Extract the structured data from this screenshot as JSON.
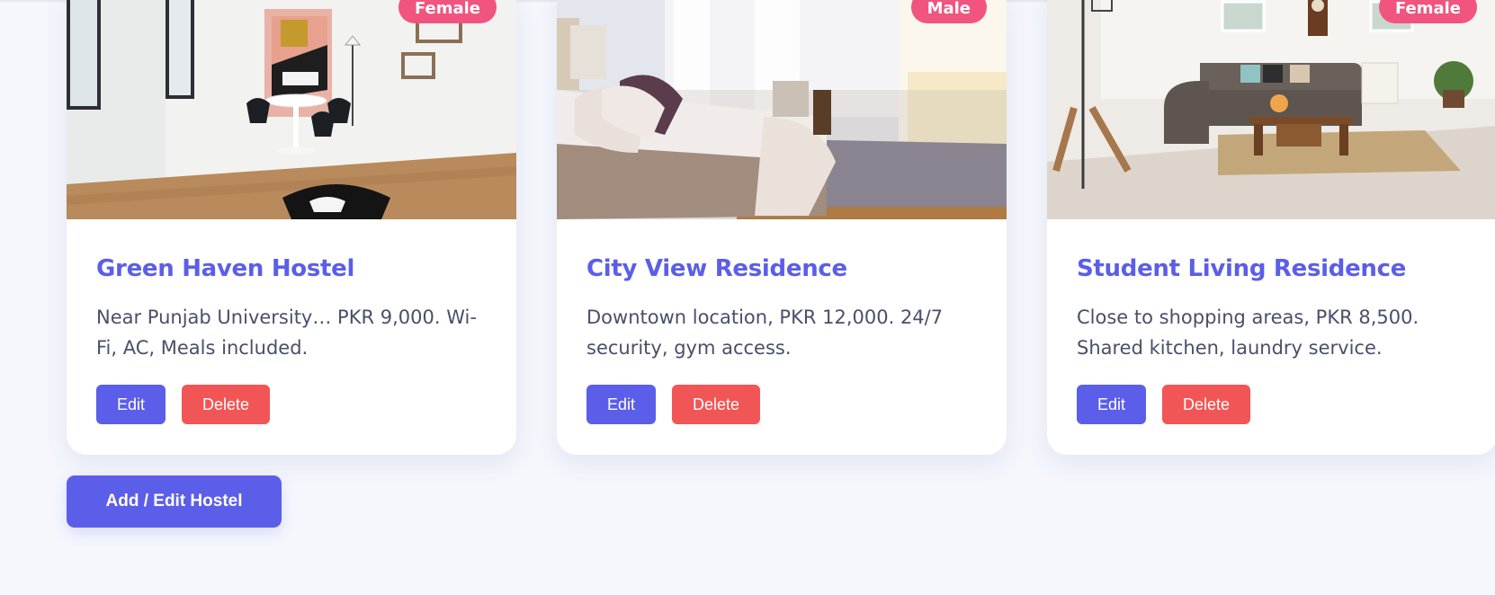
{
  "hostels": [
    {
      "gender_badge": "Female",
      "name": "Green Haven Hostel",
      "description": "Near Punjab University… PKR 9,000. Wi-Fi, AC, Meals included.",
      "edit_label": "Edit",
      "delete_label": "Delete",
      "photo_icon": "dining-room-photo"
    },
    {
      "gender_badge": "Male",
      "name": "City View Residence",
      "description": "Downtown location, PKR 12,000. 24/7 security, gym access.",
      "edit_label": "Edit",
      "delete_label": "Delete",
      "photo_icon": "bedroom-photo"
    },
    {
      "gender_badge": "Female",
      "name": "Student Living Residence",
      "description": "Close to shopping areas, PKR 8,500. Shared kitchen, laundry service.",
      "edit_label": "Edit",
      "delete_label": "Delete",
      "photo_icon": "living-room-photo"
    }
  ],
  "add_button_label": "Add / Edit Hostel",
  "colors": {
    "primary": "#5b5ee8",
    "danger": "#f25555",
    "badge": "#f0547f",
    "background": "#f5f7fd",
    "text": "#4a4f6a"
  }
}
